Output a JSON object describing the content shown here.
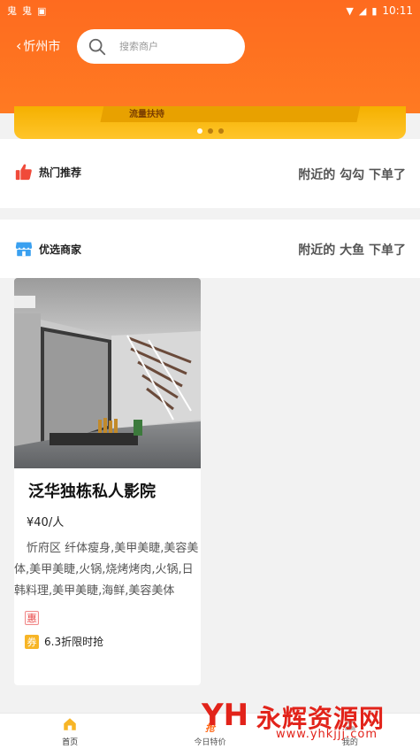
{
  "status_bar": {
    "time": "10:11"
  },
  "header": {
    "city": "忻州市",
    "search_placeholder": "搜索商户"
  },
  "banner": {
    "text": "流量扶持"
  },
  "hot": {
    "title": "热门推荐",
    "notice": "附近的 勾勾 下单了"
  },
  "shops": {
    "title": "优选商家",
    "notice": "附近的 大鱼 下单了"
  },
  "card": {
    "name": "泛华独栋私人影院",
    "price": "¥40/人",
    "district": "忻府区",
    "tags": "纤体瘦身,美甲美睫,美容美体,美甲美睫,火锅,烧烤烤肉,火锅,日韩料理,美甲美睫,海鲜,美容美体",
    "hui_label": "惠",
    "quan_label": "券",
    "coupon": "6.3折限时抢"
  },
  "tabbar": {
    "items": [
      {
        "label": "首页"
      },
      {
        "label": "今日特价",
        "promo": "抢"
      },
      {
        "label": "我的"
      }
    ]
  },
  "watermark": {
    "logo": "YH",
    "title": "永辉资源网",
    "url": "www.yhkjjj.com"
  },
  "colors": {
    "primary": "#fe6b1f",
    "banner": "#ffc52a",
    "hot_icon": "#f04a3a",
    "shop_icon": "#3aa0f0",
    "watermark": "#e2231a"
  }
}
